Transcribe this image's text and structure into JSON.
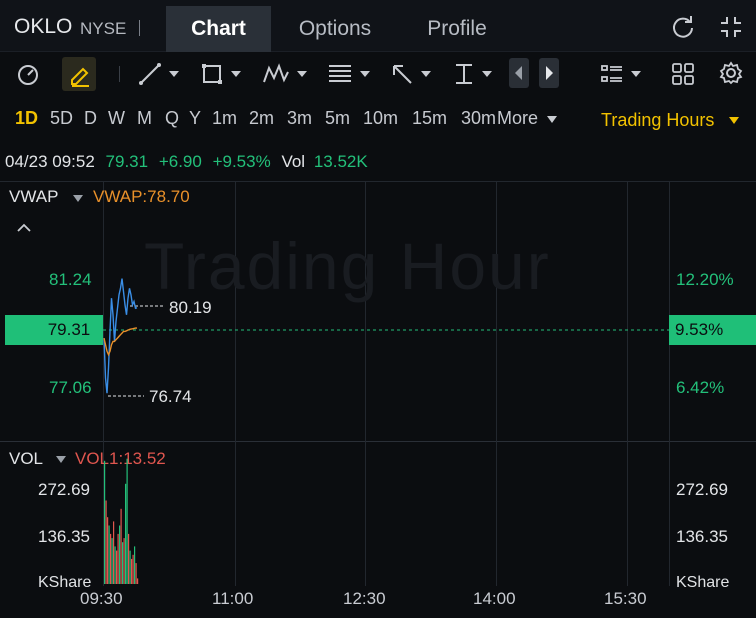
{
  "header": {
    "ticker": "OKLO",
    "exchange": "NYSE",
    "tabs": [
      {
        "label": "Chart",
        "active": true
      },
      {
        "label": "Options",
        "active": false
      },
      {
        "label": "Profile",
        "active": false
      }
    ],
    "icons": [
      "refresh-icon",
      "fullscreen-icon"
    ]
  },
  "toolbar": {
    "tools": [
      "crosshair-icon",
      "pen-icon",
      "trendline-icon",
      "rectangle-icon",
      "pattern-icon",
      "fib-icon",
      "arrow-draw-icon",
      "measure-icon",
      "prev-icon",
      "next-icon",
      "layout-list-icon",
      "grid-icon",
      "gear-icon"
    ]
  },
  "periods": {
    "items": [
      "1D",
      "5D",
      "D",
      "W",
      "M",
      "Q",
      "Y",
      "1m",
      "2m",
      "3m",
      "5m",
      "10m",
      "15m",
      "30m"
    ],
    "active": "1D",
    "more_label": "More",
    "session_label": "Trading Hours"
  },
  "quote": {
    "datetime": "04/23 09:52",
    "price": "79.31",
    "change": "+6.90",
    "change_pct": "+9.53%",
    "vol_label": "Vol",
    "vol_value": "13.52K"
  },
  "colors": {
    "up": "#23c07a",
    "accent": "#f2c200",
    "vwap": "#e8902a",
    "price_line": "#3a8ee6",
    "vol_red": "#e0564f"
  },
  "price_panel": {
    "indicator": "VWAP",
    "vwap_text": "VWAP:78.70",
    "watermark": "Trading Hour",
    "left_ticks": [
      "81.24",
      "77.06"
    ],
    "right_ticks": [
      "12.20%",
      "6.42%"
    ],
    "current_price": "79.31",
    "current_pct": "9.53%",
    "high_marker": "80.19",
    "low_marker": "76.74"
  },
  "volume_panel": {
    "indicator": "VOL",
    "vol_text": "VOL1:13.52",
    "ticks": [
      "272.69",
      "136.35"
    ],
    "unit": "KShare"
  },
  "x_axis": [
    "09:30",
    "11:00",
    "12:30",
    "14:00",
    "15:30"
  ],
  "chart_data": [
    {
      "type": "line",
      "title": "",
      "x": [
        "09:30",
        "09:31",
        "09:32",
        "09:33",
        "09:34",
        "09:35",
        "09:36",
        "09:37",
        "09:38",
        "09:39",
        "09:40",
        "09:41",
        "09:42",
        "09:43",
        "09:44",
        "09:45",
        "09:46",
        "09:47",
        "09:48",
        "09:49",
        "09:50",
        "09:51",
        "09:52"
      ],
      "series": [
        {
          "name": "",
          "values": [
            78.4,
            77.2,
            76.74,
            77.5,
            78.6,
            79.6,
            79.1,
            78.3,
            78.9,
            79.3,
            79.7,
            79.9,
            80.19,
            79.8,
            79.4,
            79.1,
            79.6,
            79.9,
            79.7,
            79.4,
            79.5,
            79.3,
            79.31
          ]
        },
        {
          "name": "VWAP",
          "values": [
            78.4,
            78.2,
            78.0,
            77.9,
            78.0,
            78.2,
            78.3,
            78.3,
            78.35,
            78.4,
            78.45,
            78.5,
            78.55,
            78.6,
            78.6,
            78.62,
            78.64,
            78.66,
            78.67,
            78.68,
            78.69,
            78.7,
            78.7
          ]
        }
      ],
      "ylim": [
        75.3,
        83.1
      ],
      "yticks": [
        81.24,
        77.06
      ],
      "current": 79.31
    },
    {
      "type": "bar",
      "title": "",
      "ylabel": "KShare",
      "x": [
        "09:30",
        "09:31",
        "09:32",
        "09:33",
        "09:34",
        "09:35",
        "09:36",
        "09:37",
        "09:38",
        "09:39",
        "09:40",
        "09:41",
        "09:42",
        "09:43",
        "09:44",
        "09:45",
        "09:46",
        "09:47",
        "09:48",
        "09:49",
        "09:50",
        "09:51",
        "09:52"
      ],
      "values": [
        295,
        200,
        160,
        140,
        120,
        110,
        150,
        90,
        80,
        120,
        140,
        180,
        100,
        110,
        240,
        300,
        120,
        80,
        60,
        70,
        90,
        50,
        13.52
      ],
      "colors": [
        "up",
        "down",
        "down",
        "up",
        "down",
        "up",
        "down",
        "up",
        "down",
        "down",
        "up",
        "down",
        "up",
        "down",
        "up",
        "up",
        "down",
        "up",
        "down",
        "down",
        "up",
        "down",
        "down"
      ],
      "ylim": [
        0,
        340
      ],
      "yticks": [
        272.69,
        136.35
      ]
    }
  ]
}
